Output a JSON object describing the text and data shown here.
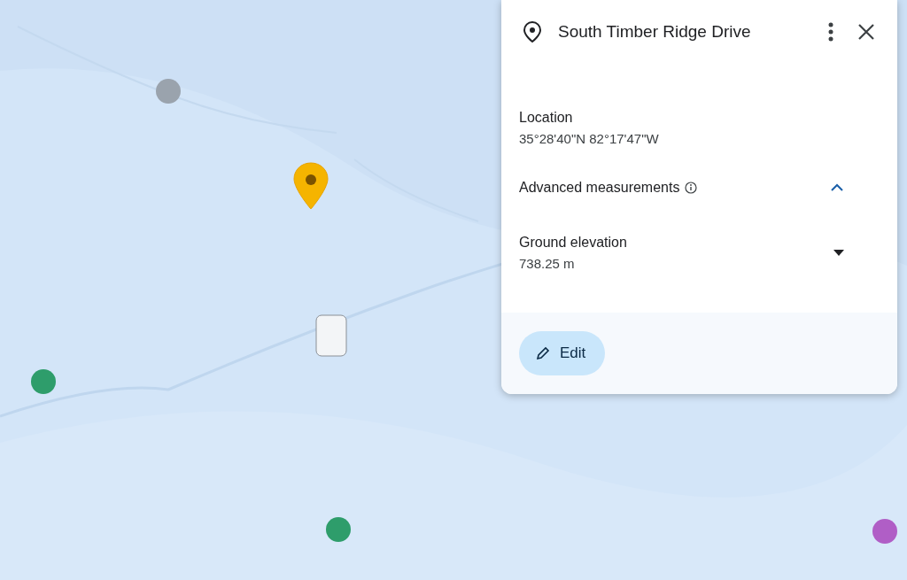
{
  "place_panel": {
    "title": "South Timber Ridge Drive",
    "location": {
      "label": "Location",
      "value": "35°28'40\"N 82°17'47\"W"
    },
    "advanced": {
      "label": "Advanced measurements",
      "expanded": true
    },
    "elevation": {
      "label": "Ground elevation",
      "value": "738.25 m"
    },
    "edit_button": "Edit"
  }
}
